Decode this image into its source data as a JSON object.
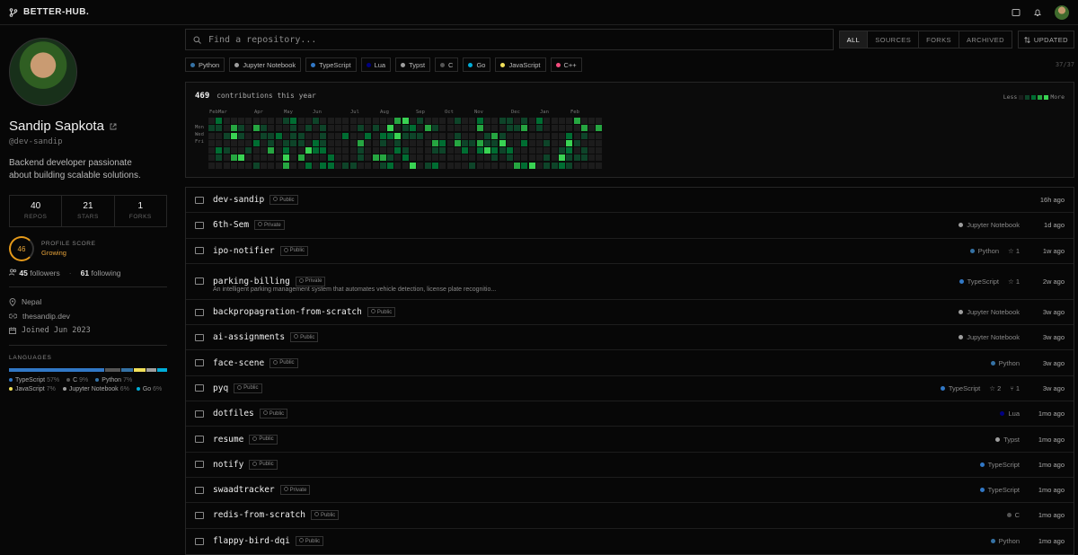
{
  "brand": "BETTER-HUB.",
  "profile": {
    "name": "Sandip Sapkota",
    "handle": "@dev-sandip",
    "bio": "Backend developer passionate about building scalable solutions.",
    "stats": [
      {
        "num": "40",
        "label": "REPOS"
      },
      {
        "num": "21",
        "label": "STARS"
      },
      {
        "num": "1",
        "label": "FORKS"
      }
    ],
    "score": {
      "value": "46",
      "label": "PROFILE SCORE",
      "status": "Growing",
      "color": "#e59a1a"
    },
    "followers": "45",
    "followers_label": "followers",
    "following": "61",
    "following_label": "following",
    "location": "Nepal",
    "website": "thesandip.dev",
    "joined": "Joined Jun 2023",
    "languages_title": "LANGUAGES",
    "languages": [
      {
        "name": "TypeScript",
        "pct": "57%",
        "color": "#3178c6",
        "share": 57
      },
      {
        "name": "C",
        "pct": "9%",
        "color": "#555555",
        "share": 9
      },
      {
        "name": "Python",
        "pct": "7%",
        "color": "#3572a5",
        "share": 7
      },
      {
        "name": "JavaScript",
        "pct": "7%",
        "color": "#f1e05a",
        "share": 7
      },
      {
        "name": "Jupyter Notebook",
        "pct": "6%",
        "color": "#9e9e9e",
        "share": 6
      },
      {
        "name": "Go",
        "pct": "6%",
        "color": "#00add8",
        "share": 6
      }
    ]
  },
  "search": {
    "placeholder": "Find a repository..."
  },
  "filters": [
    "ALL",
    "SOURCES",
    "FORKS",
    "ARCHIVED"
  ],
  "sort_label": "UPDATED",
  "chips": [
    {
      "label": "Python",
      "color": "#3572a5"
    },
    {
      "label": "Jupyter Notebook",
      "color": "#9e9e9e"
    },
    {
      "label": "TypeScript",
      "color": "#3178c6"
    },
    {
      "label": "Lua",
      "color": "#000080"
    },
    {
      "label": "Typst",
      "color": "#9e9e9e"
    },
    {
      "label": "C",
      "color": "#555555"
    },
    {
      "label": "Go",
      "color": "#00add8"
    },
    {
      "label": "JavaScript",
      "color": "#f1e05a"
    },
    {
      "label": "C++",
      "color": "#f34b7d"
    }
  ],
  "repo_count": "37/37",
  "contributions": {
    "count": "469",
    "label": "contributions this year",
    "less": "Less",
    "more": "More",
    "months": [
      "Feb",
      "Mar",
      "Apr",
      "May",
      "Jun",
      "Jul",
      "Aug",
      "Sep",
      "Oct",
      "Nov",
      "Dec",
      "Jan",
      "Feb"
    ],
    "days": [
      "Mon",
      "Wed",
      "Fri"
    ]
  },
  "repos": [
    {
      "name": "dev-sandip",
      "visibility": "Public",
      "lang": "",
      "color": "",
      "stars": "",
      "forks": "",
      "time": "16h ago"
    },
    {
      "name": "6th-Sem",
      "visibility": "Private",
      "lang": "Jupyter Notebook",
      "color": "#9e9e9e",
      "stars": "",
      "forks": "",
      "time": "1d ago"
    },
    {
      "name": "ipo-notifier",
      "visibility": "Public",
      "lang": "Python",
      "color": "#3572a5",
      "stars": "1",
      "forks": "",
      "time": "1w ago"
    },
    {
      "name": "parking-billing",
      "visibility": "Private",
      "desc": "An intelligent parking management system that automates vehicle detection, license plate recognitio...",
      "lang": "TypeScript",
      "color": "#3178c6",
      "stars": "1",
      "forks": "",
      "time": "2w ago"
    },
    {
      "name": "backpropagration-from-scratch",
      "visibility": "Public",
      "lang": "Jupyter Notebook",
      "color": "#9e9e9e",
      "stars": "",
      "forks": "",
      "time": "3w ago"
    },
    {
      "name": "ai-assignments",
      "visibility": "Public",
      "lang": "Jupyter Notebook",
      "color": "#9e9e9e",
      "stars": "",
      "forks": "",
      "time": "3w ago"
    },
    {
      "name": "face-scene",
      "visibility": "Public",
      "lang": "Python",
      "color": "#3572a5",
      "stars": "",
      "forks": "",
      "time": "3w ago"
    },
    {
      "name": "pyq",
      "visibility": "Public",
      "lang": "TypeScript",
      "color": "#3178c6",
      "stars": "2",
      "forks": "1",
      "time": "3w ago"
    },
    {
      "name": "dotfiles",
      "visibility": "Public",
      "lang": "Lua",
      "color": "#000080",
      "stars": "",
      "forks": "",
      "time": "1mo ago"
    },
    {
      "name": "resume",
      "visibility": "Public",
      "lang": "Typst",
      "color": "#9e9e9e",
      "stars": "",
      "forks": "",
      "time": "1mo ago"
    },
    {
      "name": "notify",
      "visibility": "Public",
      "lang": "TypeScript",
      "color": "#3178c6",
      "stars": "",
      "forks": "",
      "time": "1mo ago"
    },
    {
      "name": "swaadtracker",
      "visibility": "Private",
      "lang": "TypeScript",
      "color": "#3178c6",
      "stars": "",
      "forks": "",
      "time": "1mo ago"
    },
    {
      "name": "redis-from-scratch",
      "visibility": "Public",
      "lang": "C",
      "color": "#555555",
      "stars": "",
      "forks": "",
      "time": "1mo ago"
    },
    {
      "name": "flappy-bird-dqi",
      "visibility": "Public",
      "lang": "Python",
      "color": "#3572a5",
      "stars": "",
      "forks": "",
      "time": "1mo ago"
    }
  ]
}
